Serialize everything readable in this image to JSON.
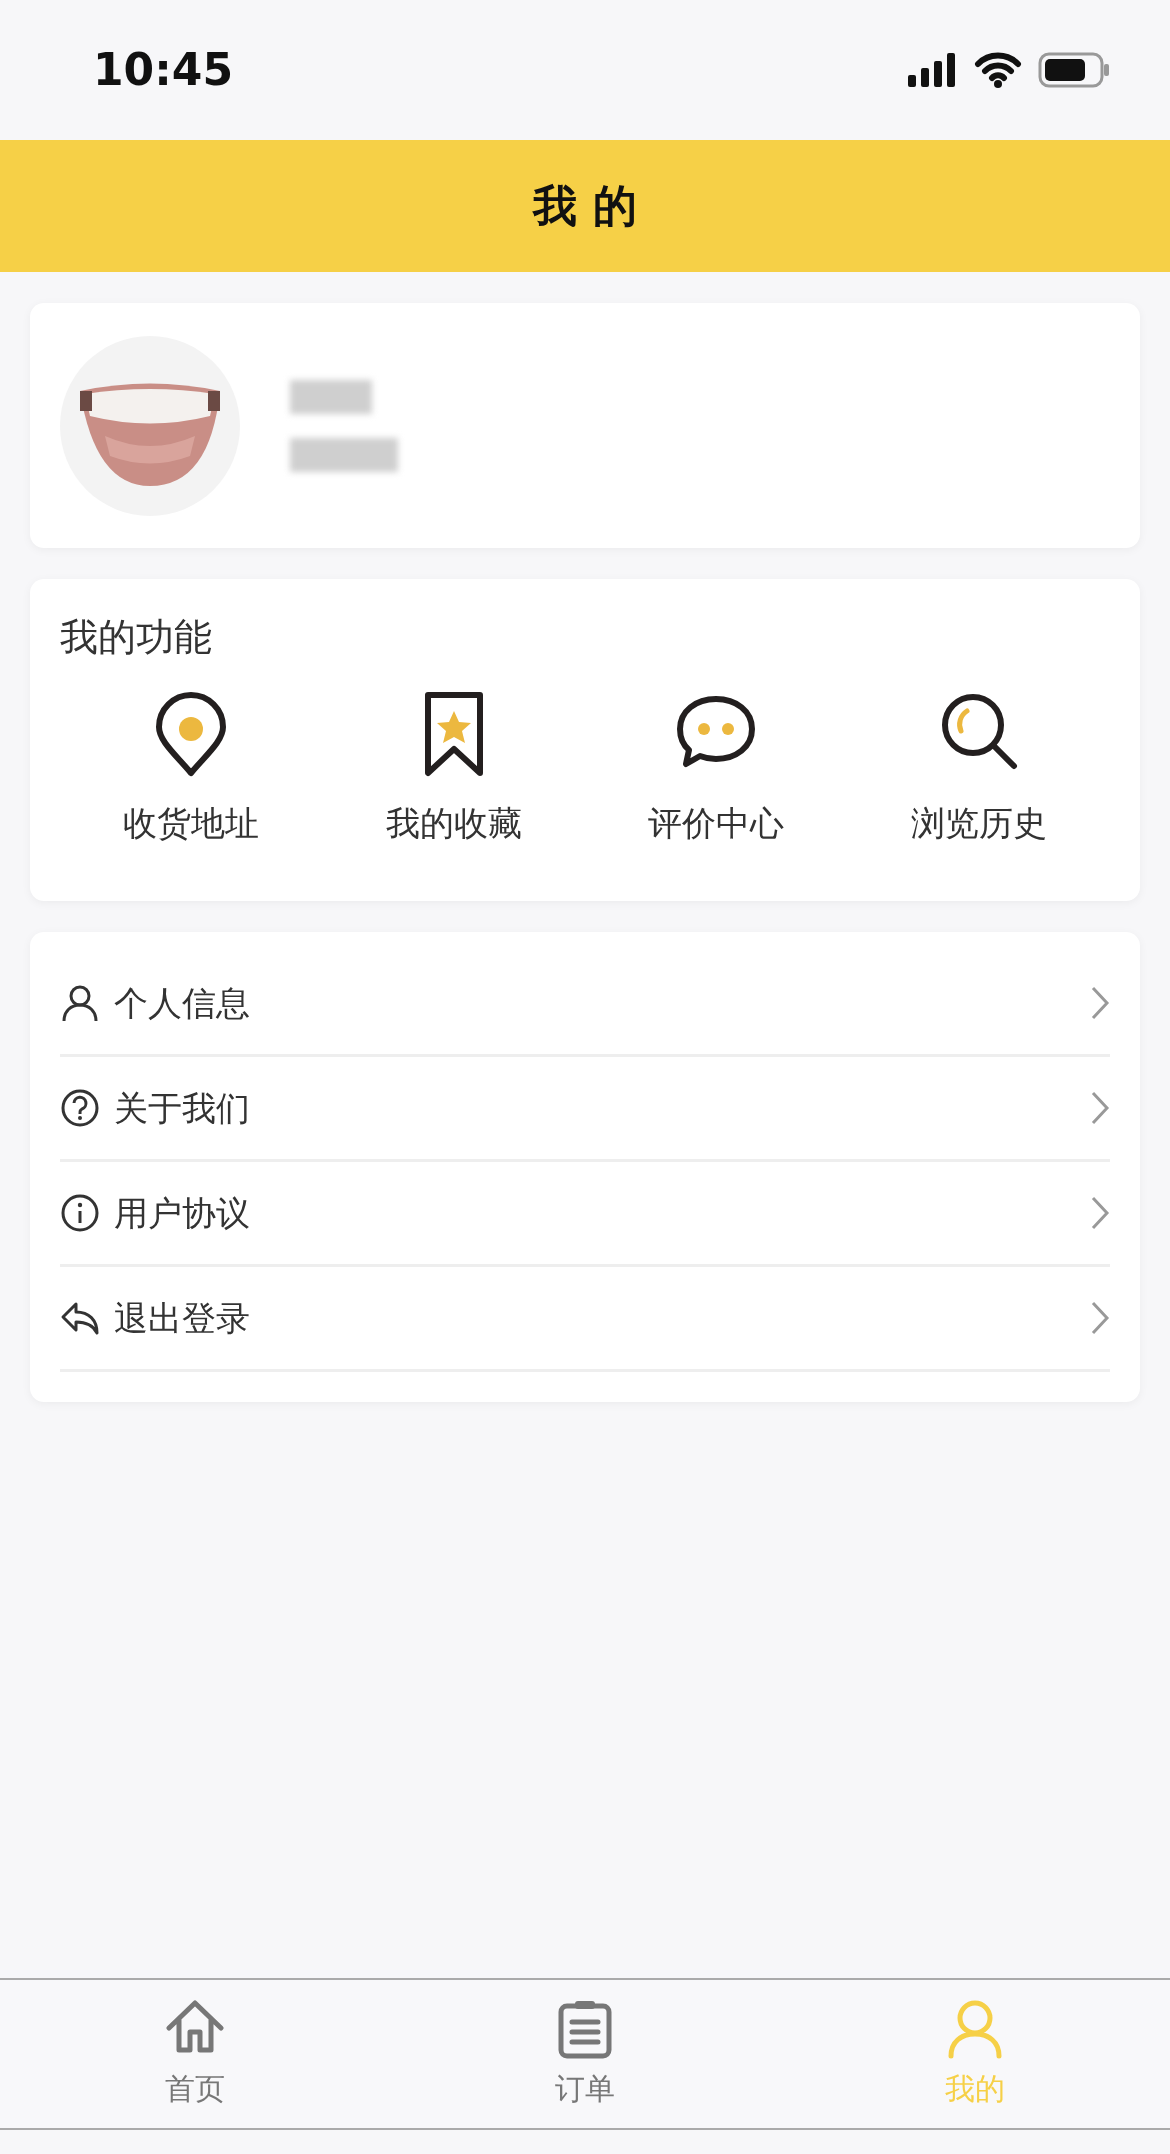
{
  "status_bar": {
    "time": "10:45"
  },
  "header": {
    "title": "我 的"
  },
  "functions": {
    "title": "我的功能",
    "items": [
      {
        "kind": "pin",
        "label": "收货地址"
      },
      {
        "kind": "bookmark",
        "label": "我的收藏"
      },
      {
        "kind": "chat",
        "label": "评价中心"
      },
      {
        "kind": "search",
        "label": "浏览历史"
      }
    ]
  },
  "menu": [
    {
      "kind": "person",
      "label": "个人信息"
    },
    {
      "kind": "question",
      "label": "关于我们"
    },
    {
      "kind": "info",
      "label": "用户协议"
    },
    {
      "kind": "back",
      "label": "退出登录"
    }
  ],
  "tab_bar": [
    {
      "kind": "home",
      "label": "首页",
      "selected": false
    },
    {
      "kind": "order",
      "label": "订单",
      "selected": false
    },
    {
      "kind": "person",
      "label": "我的",
      "selected": true
    }
  ]
}
